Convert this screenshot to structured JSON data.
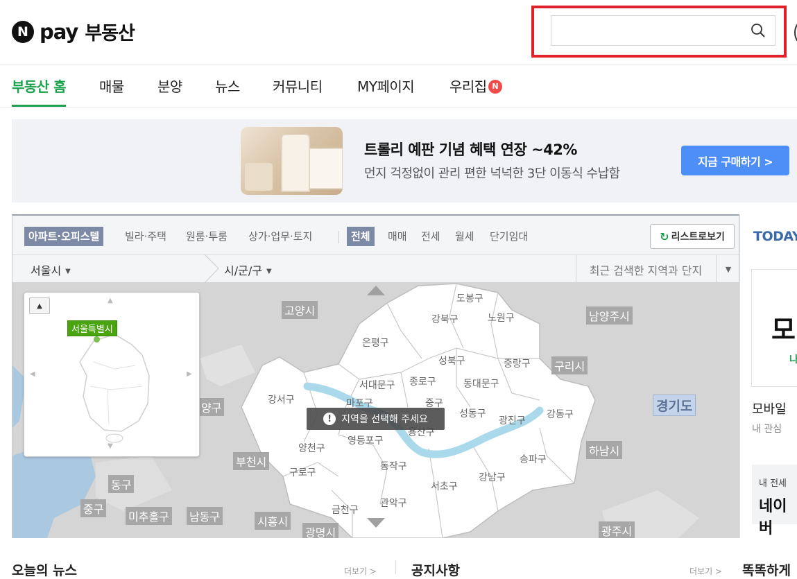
{
  "header": {
    "logo_n": "N",
    "logo_pay": "pay",
    "service_name": "부동산",
    "search_placeholder": "",
    "search_value": ""
  },
  "gnb": {
    "items": [
      {
        "label": "부동산 홈"
      },
      {
        "label": "매물"
      },
      {
        "label": "분양"
      },
      {
        "label": "뉴스"
      },
      {
        "label": "커뮤니티"
      },
      {
        "label": "MY페이지"
      },
      {
        "label": "우리집"
      }
    ],
    "new_badge": "N"
  },
  "banner": {
    "title": "트롤리 예판 기념 혜택 연장 ~42%",
    "subtitle": "먼지 걱정없이 관리 편한 넉넉한 3단 이동식 수납함",
    "button": "지금 구매하기 >"
  },
  "map": {
    "property_tabs": [
      "아파트·오피스텔",
      "빌라·주택",
      "원룸·투룸",
      "상가·업무·토지"
    ],
    "deal_tabs": [
      "전체",
      "매매",
      "전세",
      "월세",
      "단기임대"
    ],
    "list_button": "리스트로보기",
    "filter_city": "서울시",
    "filter_district": "시/군/구",
    "recent_search": "최근 검색한 지역과 단지",
    "toast": "지역을 선택해 주세요",
    "minimap_label": "서울특별시",
    "cities": [
      "고양시",
      "남양주시",
      "구리시",
      "경기도",
      "하남시",
      "부천시",
      "동구",
      "중구",
      "미추홀구",
      "남동구",
      "시흥시",
      "광명시",
      "광주시",
      "양구"
    ],
    "districts": [
      "도봉구",
      "강북구",
      "노원구",
      "은평구",
      "성북구",
      "중랑구",
      "서대문구",
      "종로구",
      "동대문구",
      "강서구",
      "마포구",
      "중구",
      "성동구",
      "광진구",
      "강동구",
      "용산구",
      "양천구",
      "영등포구",
      "송파구",
      "구로구",
      "동작구",
      "서초구",
      "강남구",
      "관악구",
      "금천구"
    ]
  },
  "right_panel": {
    "today_title": "TODAY",
    "card_big": "모",
    "card_green": "나",
    "mobile_title": "모바일",
    "mobile_sub": "내 관심",
    "ad_small": "내 전세",
    "ad_big": "네이버"
  },
  "bottom": {
    "news_title": "오늘의 뉴스",
    "news_more": "더보기 >",
    "notice_title": "공지사항",
    "notice_more": "더보기 >",
    "third_title": "똑똑하게"
  },
  "colors": {
    "brand_green": "#1ba14b",
    "highlight_red": "#e0202a",
    "button_blue": "#4d8ef7",
    "tab_selected": "#7c8aa5"
  }
}
